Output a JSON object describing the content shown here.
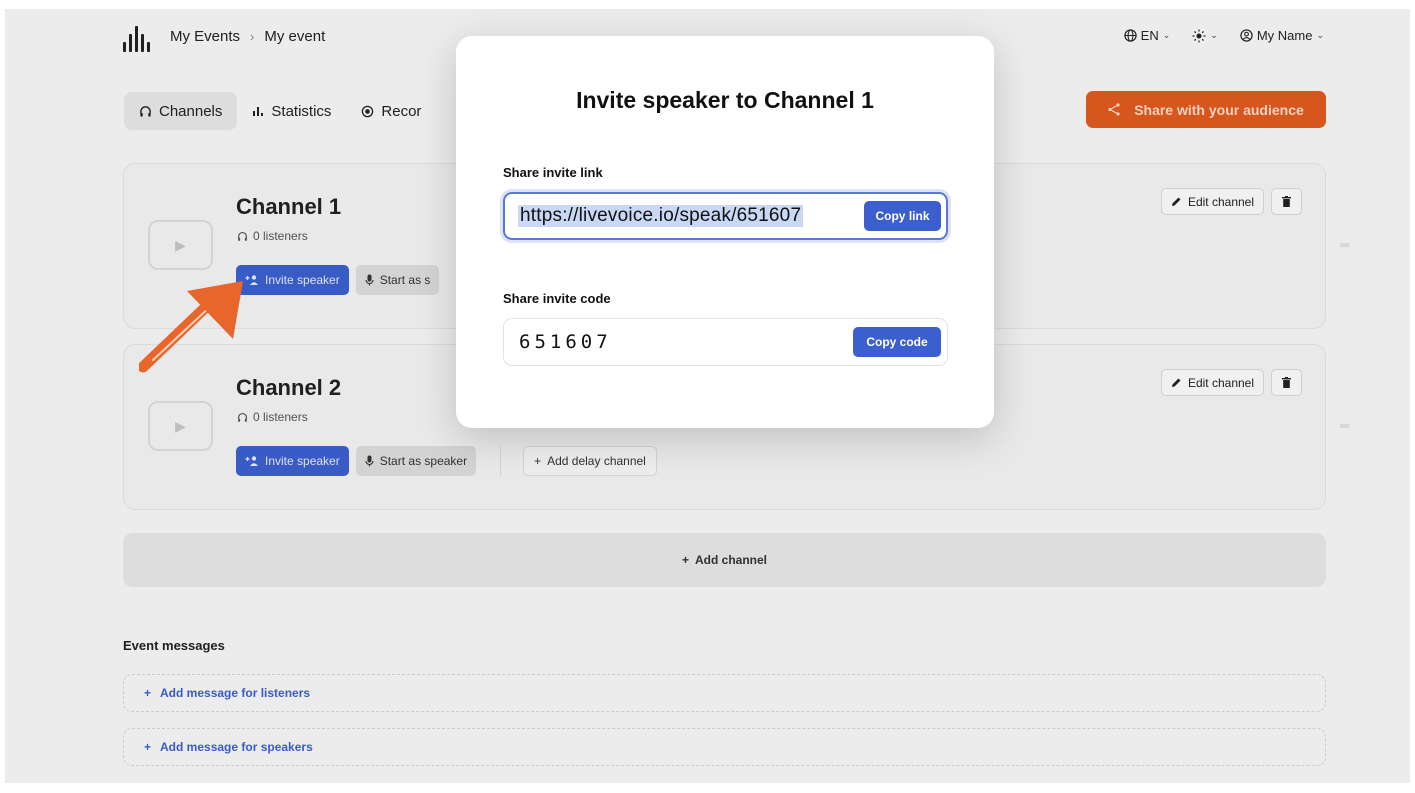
{
  "header": {
    "breadcrumb": [
      "My Events",
      "My event"
    ],
    "breadcrumb_sep": "›",
    "language": "EN",
    "user": "My Name"
  },
  "tabs": [
    {
      "label": "Channels",
      "icon": "headphones-icon",
      "active": true
    },
    {
      "label": "Statistics",
      "icon": "bar-chart-icon",
      "active": false
    },
    {
      "label": "Recor",
      "icon": "record-icon",
      "active": false
    }
  ],
  "share_button": {
    "label": "Share with your audience",
    "icon": "share-icon"
  },
  "channels": [
    {
      "title": "Channel 1",
      "listeners": "0 listeners",
      "invite_label": "Invite speaker",
      "start_label": "Start as s"
    },
    {
      "title": "Channel 2",
      "listeners": "0 listeners",
      "invite_label": "Invite speaker",
      "start_label": "Start as speaker",
      "delay_label": "Add delay channel"
    }
  ],
  "edit_channel_label": "Edit channel",
  "add_channel_label": "Add channel",
  "event_messages": {
    "title": "Event messages",
    "listeners_label": "Add message for listeners",
    "speakers_label": "Add message for speakers"
  },
  "modal": {
    "title": "Invite speaker to Channel 1",
    "link_label": "Share invite link",
    "link_value": "https://livevoice.io/speak/651607",
    "copy_link_label": "Copy link",
    "code_label": "Share invite code",
    "code_value": "651607",
    "copy_code_label": "Copy code"
  },
  "colors": {
    "accent_blue": "#3c5fcf",
    "share_orange": "#e05a20",
    "arrow_orange": "#f26b2e"
  }
}
